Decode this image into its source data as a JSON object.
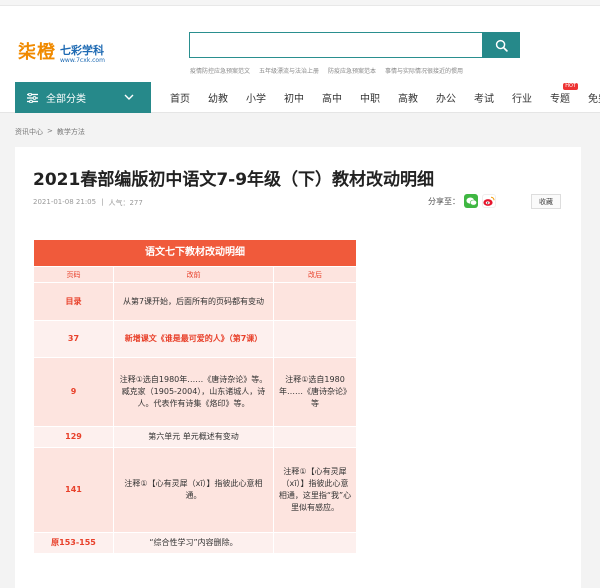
{
  "logo": {
    "mark": "柒橙",
    "name": "七彩学科",
    "url": "www.7cxk.com"
  },
  "search": {
    "placeholder": "",
    "value": ""
  },
  "hotwords": [
    "疫情防控应急预案范文",
    "五年级漂流与法治上册",
    "防疫应急预案范本",
    "事情与实际情况很接近的惯用"
  ],
  "nav": {
    "all_label": "全部分类",
    "links": [
      "首页",
      "幼教",
      "小学",
      "初中",
      "高中",
      "中职",
      "高教",
      "办公",
      "考试",
      "行业",
      "专题",
      "免费区"
    ],
    "hot_badge": "HOT"
  },
  "breadcrumb": [
    "资讯中心",
    ">",
    "教学方法"
  ],
  "article": {
    "title": "2021春部编版初中语文7-9年级（下）教材改动明细",
    "date": "2021-01-08 21:05",
    "sep": "|",
    "views": "人气：277",
    "share_label": "分享至：",
    "fav_label": "收藏"
  },
  "table": {
    "caption": "语文七下教材改动明细",
    "headers": [
      "页码",
      "改前",
      "改后"
    ],
    "rows": [
      {
        "page": "目录",
        "before": "从第7课开始，后面所有的页码都有变动",
        "after": ""
      },
      {
        "page": "37",
        "before": "新增课文《谁是最可爱的人》（第7课）",
        "after": ""
      },
      {
        "page": "9",
        "before": "注释①选自1980年……《唐诗杂论》等。臧克家（1905-2004），山东诸城人，诗人。代表作有诗集《烙印》等。",
        "after": "注释①选自1980年……《唐诗杂论》等"
      },
      {
        "page": "129",
        "before": "第六单元  单元概述有变动",
        "after": ""
      },
      {
        "page": "141",
        "before": "注释①【心有灵犀（xī）】指彼此心意相通。",
        "after": "注释①【心有灵犀（xī）】指彼此心意相通，这里指“我”心里似有感应。"
      },
      {
        "page": "原153-155",
        "before": "“综合性学习”内容删除。",
        "after": ""
      }
    ]
  },
  "colors": {
    "accent": "#26898a",
    "table_header": "#f05a3b",
    "table_row": "#fde4df",
    "brand_orange": "#f08a00"
  }
}
